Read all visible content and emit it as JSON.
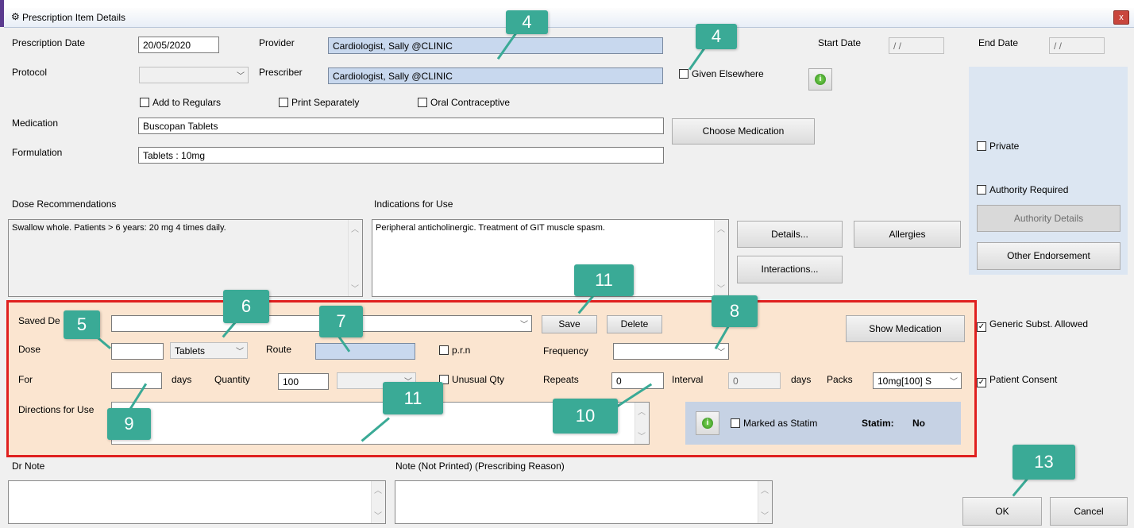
{
  "window": {
    "title": "Prescription Item Details",
    "close_label": "x"
  },
  "top": {
    "prescription_date_label": "Prescription Date",
    "prescription_date": "20/05/2020",
    "protocol_label": "Protocol",
    "provider_label": "Provider",
    "provider": "Cardiologist, Sally @CLINIC",
    "prescriber_label": "Prescriber",
    "prescriber": "Cardiologist, Sally @CLINIC",
    "given_elsewhere": "Given Elsewhere",
    "start_date_label": "Start Date",
    "start_date": "/ /",
    "end_date_label": "End Date",
    "end_date": "/ /",
    "add_to_regulars": "Add to Regulars",
    "print_separately": "Print Separately",
    "oral_contraceptive": "Oral Contraceptive",
    "medication_label": "Medication",
    "medication": "Buscopan Tablets",
    "formulation_label": "Formulation",
    "formulation": "Tablets : 10mg",
    "choose_medication": "Choose Medication"
  },
  "right": {
    "private": "Private",
    "authority_required": "Authority Required",
    "authority_details": "Authority Details",
    "other_endorsement": "Other Endorsement",
    "generic_subst": "Generic Subst. Allowed",
    "patient_consent": "Patient Consent"
  },
  "middle": {
    "dose_rec_label": "Dose Recommendations",
    "dose_rec": "Swallow whole. Patients > 6 years: 20 mg 4 times daily.",
    "indications_label": "Indications  for Use",
    "indications": "Peripheral anticholinergic. Treatment of GIT muscle spasm.",
    "details": "Details...",
    "allergies": "Allergies",
    "interactions": "Interactions..."
  },
  "dose_panel": {
    "saved_label": "Saved De",
    "save": "Save",
    "delete": "Delete",
    "show_medication": "Show Medication",
    "dose_label": "Dose",
    "dose_unit": "Tablets",
    "route_label": "Route",
    "prn": "p.r.n",
    "frequency_label": "Frequency",
    "for_label": "For",
    "days_label": "days",
    "quantity_label": "Quantity",
    "quantity": "100",
    "unusual_qty": "Unusual Qty",
    "repeats_label": "Repeats",
    "repeats": "0",
    "interval_label": "Interval",
    "interval": "0",
    "interval_days": "days",
    "packs_label": "Packs",
    "packs": "10mg[100] S",
    "directions_label": "Directions for Use",
    "marked_statim": "Marked as Statim",
    "statim_label": "Statim:",
    "statim_value": "No"
  },
  "bottom": {
    "dr_note_label": "Dr Note",
    "note_label": "Note (Not Printed) (Prescribing Reason)",
    "ok": "OK",
    "cancel": "Cancel"
  },
  "callouts": {
    "c4a": "4",
    "c4b": "4",
    "c5": "5",
    "c6": "6",
    "c7": "7",
    "c8": "8",
    "c9": "9",
    "c10": "10",
    "c11a": "11",
    "c11b": "11",
    "c13": "13"
  }
}
